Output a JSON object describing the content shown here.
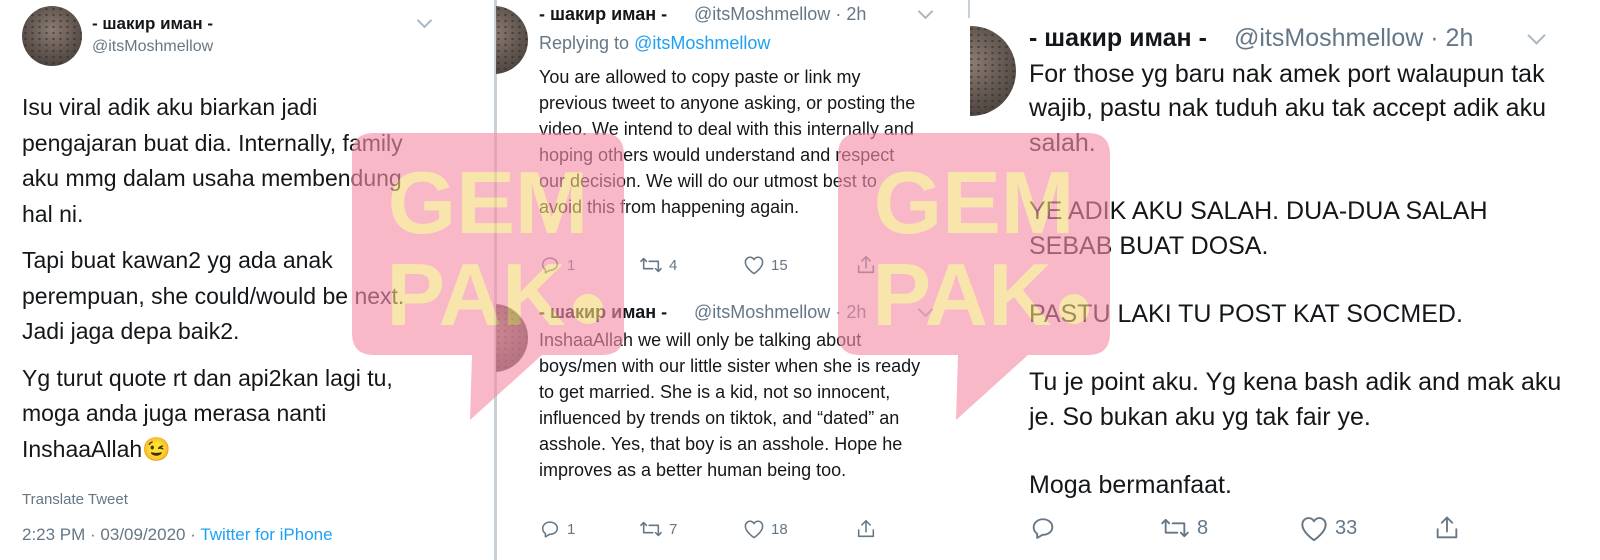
{
  "left": {
    "name": "- шакир иман -",
    "handle": "@itsMoshmellow",
    "paragraphs": [
      "Isu viral adik aku biarkan jadi pengajaran buat dia. Internally, family aku mmg dalam usaha membendung hal ni.",
      "Tapi buat kawan2 yg ada anak perempuan, she could/would be next. Jadi jaga depa baik2.",
      "Yg turut quote rt dan api2kan lagi tu, moga anda juga merasa nanti InshaaAllah😉"
    ],
    "translate": "Translate Tweet",
    "time": "2:23 PM · 03/09/2020 · ",
    "source": "Twitter for iPhone"
  },
  "middle": {
    "tweet1": {
      "name": "- шакир иман -",
      "handle": "@itsMoshmellow",
      "age": "· 2h",
      "replying_prefix": "Replying to ",
      "replying_handle": "@itsMoshmellow",
      "text": "You are allowed to copy paste or link my previous tweet to anyone asking, or posting the video. We intend to deal with this internally and hoping others would understand and respect our decision. We will do our utmost best to avoid this from happening again.",
      "replies": "1",
      "retweets": "4",
      "likes": "15"
    },
    "tweet2": {
      "name": "- шакир иман -",
      "handle": "@itsMoshmellow",
      "age": "· 2h",
      "text": "InshaaAllah we will only be talking about boys/men with our little sister when she is ready to get married. She is a kid, not so innocent, influenced by trends on tiktok, and “dated” an asshole. Yes, that boy is an asshole. Hope he improves as a better human being too.",
      "replies": "1",
      "retweets": "7",
      "likes": "18"
    }
  },
  "right": {
    "name": "- шакир иман -",
    "handle": "@itsMoshmellow",
    "age": "· 2h",
    "paragraphs": [
      "For those yg baru nak amek port walaupun tak wajib, pastu nak tuduh aku tak accept adik aku salah.",
      "YE ADIK AKU SALAH. DUA-DUA SALAH SEBAB BUAT DOSA.",
      "PASTU LAKI TU POST KAT SOCMED.",
      "Tu je point aku. Yg kena bash adik and mak aku je. So bukan aku yg tak fair ye.",
      "Moga bermanfaat."
    ],
    "retweets": "8",
    "likes": "33"
  },
  "watermark": {
    "line1": "GEM",
    "line2": "PAK",
    "badge_color": "#f48ea8",
    "text_color": "#f5d67a"
  }
}
